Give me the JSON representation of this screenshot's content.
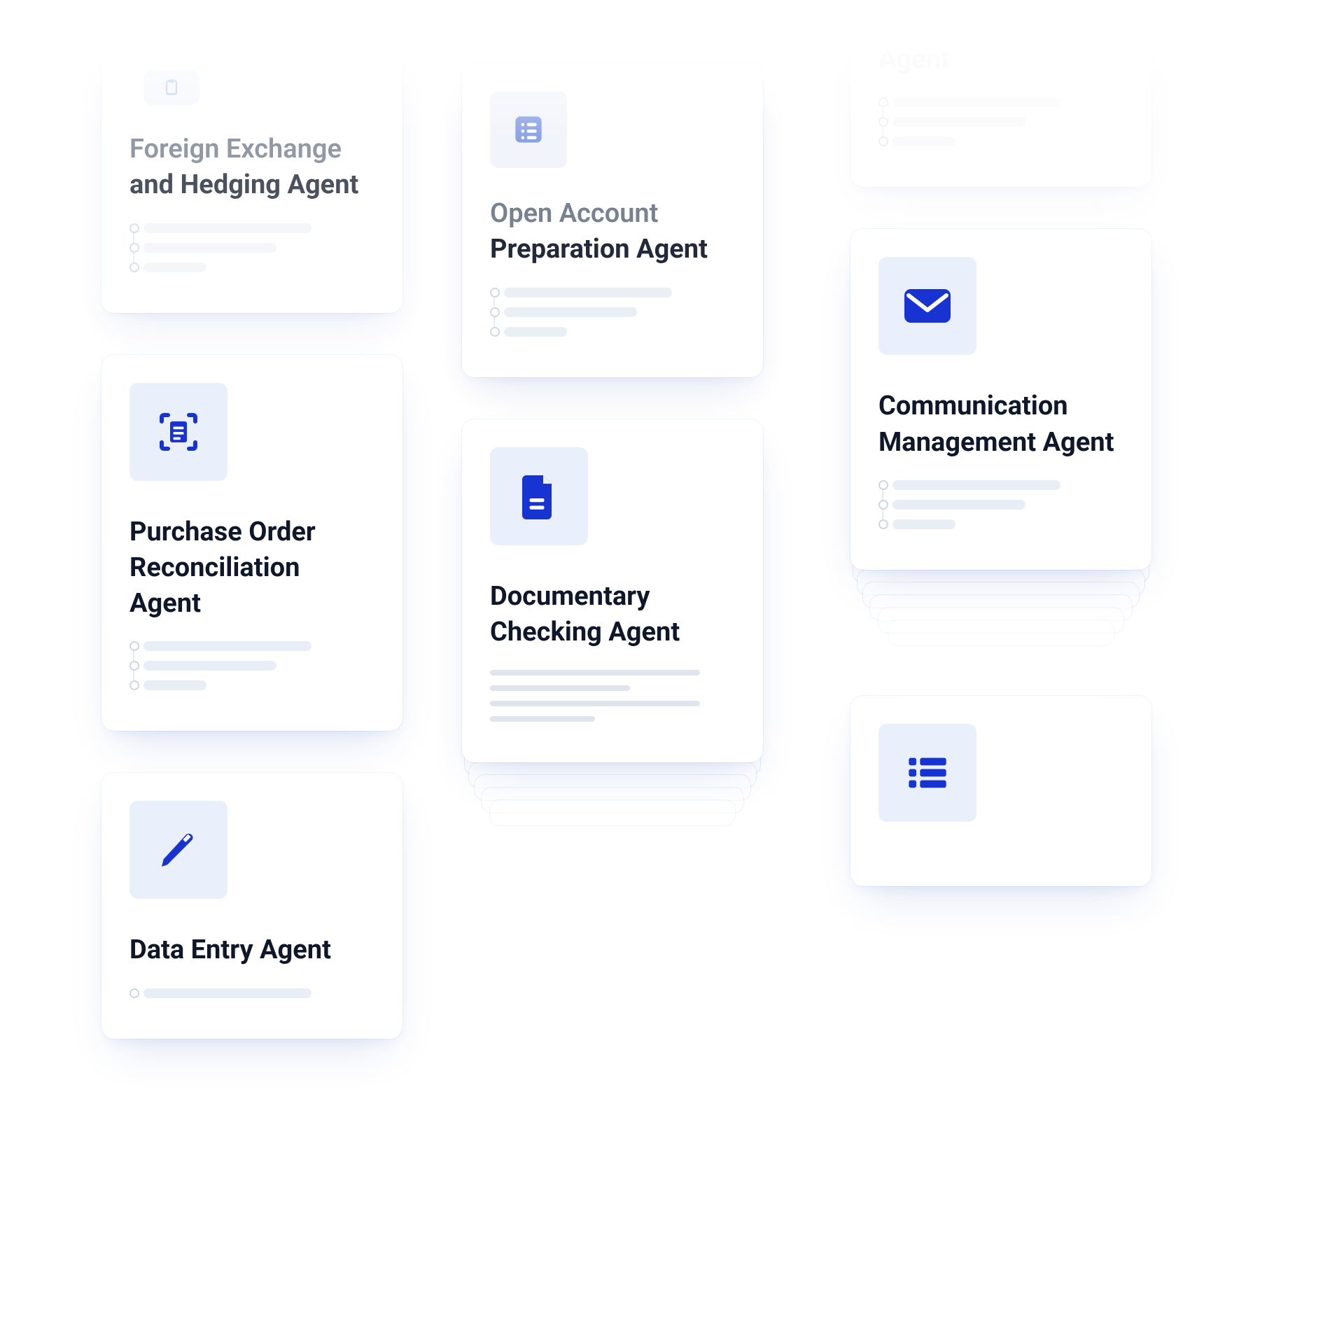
{
  "cards": {
    "foreign_exchange": {
      "title_light": "Foreign Exchange",
      "title_dark": "and Hedging Agent",
      "icon": "clipboard"
    },
    "purchase_order": {
      "title_light": "",
      "title_dark": "Purchase Order Reconciliation Agent",
      "icon": "scan-list"
    },
    "data_entry": {
      "title_light": "",
      "title_dark": "Data Entry Agent",
      "icon": "pencil"
    },
    "open_account": {
      "title_light": "Open Account",
      "title_dark": "Preparation Agent",
      "icon": "list"
    },
    "documentary": {
      "title_light": "Documentary",
      "title_dark": "Checking Agent",
      "icon": "document"
    },
    "top_right_agent": {
      "title_light": "",
      "title_dark": "Agent",
      "icon": "none"
    },
    "communication": {
      "title_light": "Communication",
      "title_dark": "Management Agent",
      "icon": "mail"
    },
    "bottom_right_partial": {
      "title_light": "",
      "title_dark": "",
      "icon": "grid-list"
    }
  }
}
